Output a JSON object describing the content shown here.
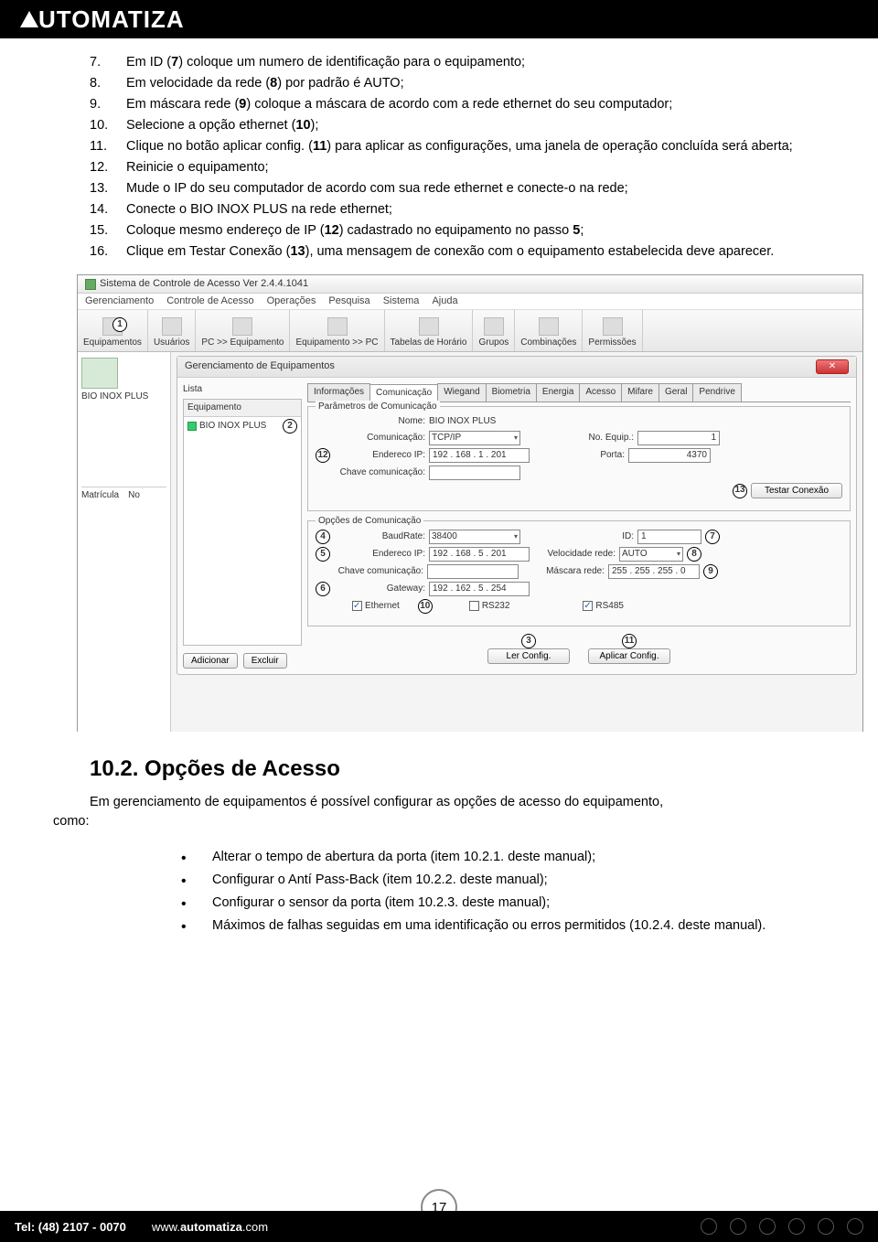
{
  "logo": "UTOMATIZA",
  "list_items": [
    {
      "n": "7.",
      "t": "Em ID (<b>7</b>) coloque um numero de identificação para o equipamento;"
    },
    {
      "n": "8.",
      "t": "Em velocidade da rede (<b>8</b>) por padrão é AUTO;"
    },
    {
      "n": "9.",
      "t": "Em máscara rede (<b>9</b>) coloque a máscara de acordo com a rede ethernet do seu computador;"
    },
    {
      "n": "10.",
      "t": "Selecione a opção ethernet (<b>10</b>);"
    },
    {
      "n": "11.",
      "t": "Clique no botão aplicar config. (<b>11</b>) para aplicar as configurações, uma janela de operação concluída será aberta;"
    },
    {
      "n": "12.",
      "t": "Reinicie o equipamento;"
    },
    {
      "n": "13.",
      "t": "Mude o IP do seu computador de acordo com sua rede ethernet e conecte-o na rede;"
    },
    {
      "n": "14.",
      "t": "Conecte o BIO INOX PLUS na rede ethernet;"
    },
    {
      "n": "15.",
      "t": "Coloque mesmo endereço de IP (<b>12</b>) cadastrado no equipamento no passo <b>5</b>;"
    },
    {
      "n": "16.",
      "t": "Clique em Testar Conexão (<b>13</b>), uma mensagem de conexão com o equipamento estabelecida deve aparecer.",
      "j": true
    }
  ],
  "ss": {
    "title": "Sistema de Controle de Acesso  Ver 2.4.4.1041",
    "menus": [
      "Gerenciamento",
      "Controle de Acesso",
      "Operações",
      "Pesquisa",
      "Sistema",
      "Ajuda"
    ],
    "tools": [
      "Equipamentos",
      "Usuários",
      "PC >> Equipamento",
      "Equipamento >> PC",
      "Tabelas de Horário",
      "Grupos",
      "Combinações",
      "Permissões"
    ],
    "left_label": "BIO INOX PLUS",
    "matric_a": "Matrícula",
    "matric_b": "No",
    "panel_title": "Gerenciamento de Equipamentos",
    "list_hdr": "Lista",
    "list_col": "Equipamento",
    "list_item": "BIO INOX PLUS",
    "btn_add": "Adicionar",
    "btn_del": "Excluir",
    "tabs": [
      "Informações",
      "Comunicação",
      "Wiegand",
      "Biometria",
      "Energia",
      "Acesso",
      "Mifare",
      "Geral",
      "Pendrive"
    ],
    "fs1": "Parâmetros de Comunicação",
    "nome_l": "Nome:",
    "nome_v": "BIO INOX PLUS",
    "com_l": "Comunicação:",
    "com_v": "TCP/IP",
    "noequip_l": "No. Equip.:",
    "noequip_v": "1",
    "end_l": "Endereco IP:",
    "end_v": "192 . 168 .  1  . 201",
    "porta_l": "Porta:",
    "porta_v": "4370",
    "chave_l": "Chave comunicação:",
    "test_btn": "Testar Conexão",
    "fs2": "Opções de Comunicação",
    "baud_l": "BaudRate:",
    "baud_v": "38400",
    "id_l": "ID:",
    "id_v": "1",
    "end2_l": "Endereco IP:",
    "end2_v": "192 . 168 .  5  . 201",
    "vel_l": "Velocidade rede:",
    "vel_v": "AUTO",
    "chave2_l": "Chave comunicação:",
    "masc_l": "Máscara rede:",
    "masc_v": "255 . 255 . 255 .  0",
    "gw_l": "Gateway:",
    "gw_v": "192 . 162 .  5  . 254",
    "eth": "Ethernet",
    "rs232": "RS232",
    "rs485": "RS485",
    "ler": "Ler Config.",
    "apl": "Aplicar Config."
  },
  "h2": "10.2.   Opções de Acesso",
  "p2": "Em gerenciamento de equipamentos é possível configurar as opções de acesso do equipamento, como:",
  "p2_pre": "como:",
  "bul": [
    "Alterar o tempo de abertura da porta (item 10.2.1. deste manual);",
    "Configurar o Antí Pass-Back (item 10.2.2. deste manual);",
    "Configurar o sensor da porta (item 10.2.3. deste manual);",
    "Máximos de falhas seguidas em uma identificação ou erros permitidos (10.2.4. deste manual)."
  ],
  "page": "17",
  "footer_tel": "Tel: (48) 2107 - 0070",
  "footer_url_pre": "www.",
  "footer_url_b": "automatiza",
  "footer_url_post": ".com"
}
